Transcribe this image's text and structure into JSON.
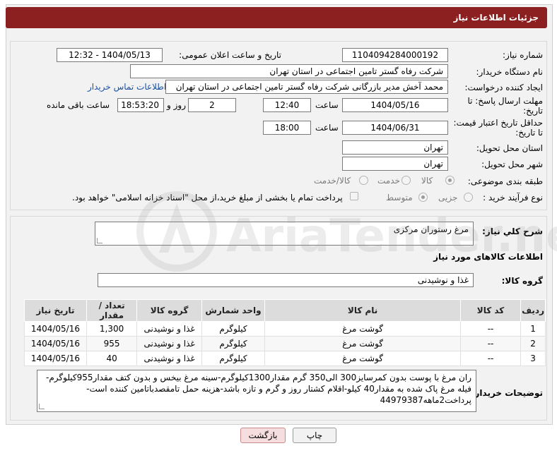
{
  "header": {
    "title": "جزئیات اطلاعات نیاز"
  },
  "labels": {
    "need_number": "شماره نیاز:",
    "announce_datetime": "تاریخ و ساعت اعلان عمومی:",
    "buyer_org": "نام دستگاه خریدار:",
    "requester": "ایجاد کننده درخواست:",
    "reply_deadline": "مهلت ارسال پاسخ: تا تاریخ:",
    "time": "ساعت",
    "day_and": "روز و",
    "remaining": "ساعت باقی مانده",
    "price_validity": "حداقل تاریخ اعتبار قیمت: تا تاریخ:",
    "delivery_province": "استان محل تحویل:",
    "delivery_city": "شهر محل تحویل:",
    "category": "طبقه بندی موضوعی:",
    "purchase_type": "نوع فرآیند خرید :",
    "need_desc": "شرح کلي نياز:",
    "goods_info": "اطلاعات کالاهای مورد نیاز",
    "goods_group": "گروه کالا:",
    "buyer_notes": "توضیحات خریدار:"
  },
  "values": {
    "need_number": "1104094284000192",
    "announce_datetime": "1404/05/13 - 12:32",
    "buyer_org": "شرکت رفاه گستر تامین اجتماعی در استان تهران",
    "requester": "محمد آخش مدیر بازرگانی شرکت رفاه گستر تامین اجتماعی در استان تهران",
    "contact_link": "اطلاعات تماس خریدار",
    "reply_date": "1404/05/16",
    "reply_time": "12:40",
    "reply_days": "2",
    "reply_remaining": "18:53:20",
    "validity_date": "1404/06/31",
    "validity_time": "18:00",
    "province": "تهران",
    "city": "تهران",
    "need_desc": "مرغ رستوران مرکزی",
    "goods_group": "غذا و نوشیدنی",
    "buyer_notes": "ران مرغ با پوست بدون کمرسایز300 الی350 گرم مقدار1300کیلوگرم-سینه مرغ بیخس و بدون کتف مقدار955کیلوگرم-فیله مرغ پاک شده به مقدار40 کیلو-اقلام کشتار روز و گرم و تازه باشد-هزینه حمل تامقصدباتامین کننده است-پرداخت2ماهه44979387"
  },
  "category_options": {
    "goods": "کالا",
    "service": "خدمت",
    "goods_service": "کالا/خدمت",
    "selected": "کالا"
  },
  "purchase_options": {
    "minor": "جزیی",
    "medium": "متوسط",
    "selected": "متوسط",
    "treasury_note": "پرداخت تمام یا بخشی از مبلغ خرید،از محل \"اسناد خزانه اسلامی\" خواهد بود."
  },
  "table": {
    "headers": {
      "row": "ردیف",
      "code": "کد کالا",
      "name": "نام کالا",
      "unit": "واحد شمارش",
      "group": "گروه کالا",
      "qty": "تعداد / مقدار",
      "date": "تاریخ نیاز"
    },
    "rows": [
      {
        "row": "1",
        "code": "--",
        "name": "گوشت مرغ",
        "unit": "کیلوگرم",
        "group": "غذا و نوشیدنی",
        "qty": "1,300",
        "date": "1404/05/16"
      },
      {
        "row": "2",
        "code": "--",
        "name": "گوشت مرغ",
        "unit": "کیلوگرم",
        "group": "غذا و نوشیدنی",
        "qty": "955",
        "date": "1404/05/16"
      },
      {
        "row": "3",
        "code": "--",
        "name": "گوشت مرغ",
        "unit": "کیلوگرم",
        "group": "غذا و نوشیدنی",
        "qty": "40",
        "date": "1404/05/16"
      }
    ]
  },
  "buttons": {
    "print": "چاپ",
    "back": "بازگشت"
  },
  "watermark": {
    "text": "AriaTender.net"
  },
  "colors": {
    "title_bar": "#8c1f1f",
    "link": "#1a4fa0",
    "back_button": "#f6dede"
  }
}
